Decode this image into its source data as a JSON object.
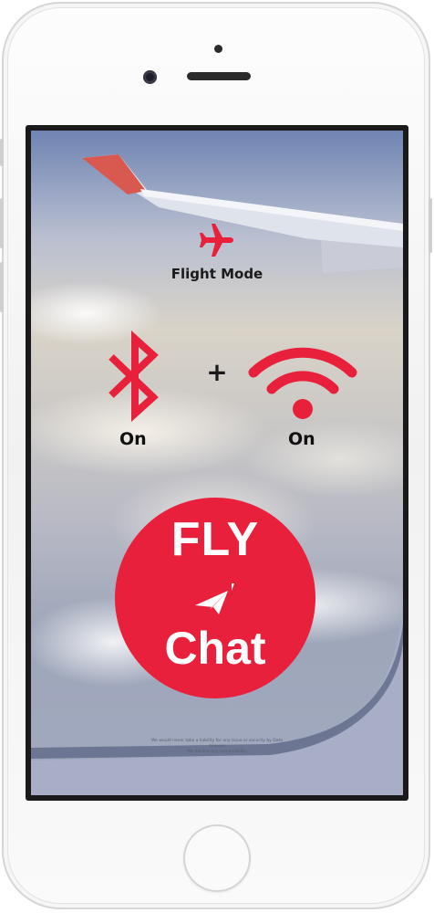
{
  "flight": {
    "label": "Flight Mode"
  },
  "connectivity": {
    "bluetooth_status": "On",
    "plus": "+",
    "wifi_status": "On"
  },
  "logo": {
    "line1": "FLY",
    "line2": "Chat"
  },
  "disclaimer": {
    "line1": "We would never take a liability for any issue or security by Data",
    "line2": "misuses",
    "line3": "We decline any responsibility"
  },
  "icons": {
    "airplane": "airplane-icon",
    "bluetooth": "bluetooth-icon",
    "wifi": "wifi-icon",
    "send": "paper-plane-icon"
  },
  "colors": {
    "accent": "#e8203b",
    "text_dark": "#1a1a1a",
    "phone_body": "#f4f4f4"
  }
}
